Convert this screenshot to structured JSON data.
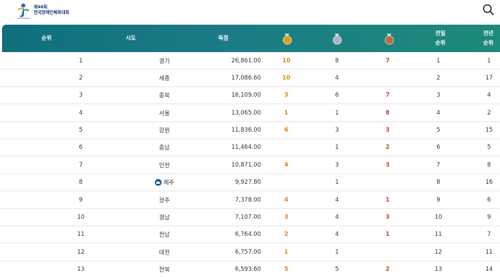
{
  "header": {
    "logo_line1": "제46회",
    "logo_line2": "전국장애인체육대회",
    "columns": {
      "rank": "순위",
      "sido": "시도",
      "score": "득점",
      "prev_day_rank_line1": "전일",
      "prev_day_rank_line2": "순위",
      "prev_year_rank_line1": "전년",
      "prev_year_rank_line2": "순위"
    },
    "medal_icons": {
      "gold": "gold-medal-icon",
      "silver": "silver-medal-icon",
      "bronze": "bronze-medal-icon"
    }
  },
  "colors": {
    "header_start": "#0f6f7c",
    "header_end": "#1d8a7a",
    "gold_text": "#d8891a",
    "bronze_text": "#b5522d"
  },
  "rows": [
    {
      "rank": "1",
      "sido": "경기",
      "score": "26,861.00",
      "gold": "10",
      "silver": "8",
      "bronze": "7",
      "prev": "1",
      "lastyr": "1"
    },
    {
      "rank": "2",
      "sido": "세종",
      "score": "17,086.60",
      "gold": "10",
      "silver": "4",
      "bronze": "",
      "prev": "2",
      "lastyr": "17"
    },
    {
      "rank": "3",
      "sido": "충북",
      "score": "16,109.00",
      "gold": "3",
      "silver": "6",
      "bronze": "7",
      "prev": "3",
      "lastyr": "4"
    },
    {
      "rank": "4",
      "sido": "서울",
      "score": "13,065.00",
      "gold": "1",
      "silver": "1",
      "bronze": "8",
      "prev": "4",
      "lastyr": "2"
    },
    {
      "rank": "5",
      "sido": "강원",
      "score": "11,836.00",
      "gold": "6",
      "silver": "3",
      "bronze": "3",
      "prev": "5",
      "lastyr": "15"
    },
    {
      "rank": "6",
      "sido": "충남",
      "score": "11,464.00",
      "gold": "",
      "silver": "1",
      "bronze": "2",
      "prev": "6",
      "lastyr": "5"
    },
    {
      "rank": "7",
      "sido": "인천",
      "score": "10,871.00",
      "gold": "4",
      "silver": "3",
      "bronze": "3",
      "prev": "7",
      "lastyr": "8"
    },
    {
      "rank": "8",
      "sido": "제주",
      "score": "9,927.80",
      "gold": "",
      "silver": "1",
      "bronze": "",
      "prev": "8",
      "lastyr": "16",
      "host": true
    },
    {
      "rank": "9",
      "sido": "광주",
      "score": "7,378.00",
      "gold": "4",
      "silver": "4",
      "bronze": "1",
      "prev": "9",
      "lastyr": "6"
    },
    {
      "rank": "10",
      "sido": "경남",
      "score": "7,107.00",
      "gold": "3",
      "silver": "4",
      "bronze": "3",
      "prev": "10",
      "lastyr": "9"
    },
    {
      "rank": "11",
      "sido": "전남",
      "score": "6,764.00",
      "gold": "2",
      "silver": "4",
      "bronze": "1",
      "prev": "11",
      "lastyr": "7"
    },
    {
      "rank": "12",
      "sido": "대전",
      "score": "6,757.00",
      "gold": "1",
      "silver": "1",
      "bronze": "",
      "prev": "12",
      "lastyr": "11"
    },
    {
      "rank": "13",
      "sido": "전북",
      "score": "6,593.60",
      "gold": "5",
      "silver": "5",
      "bronze": "2",
      "prev": "13",
      "lastyr": "14"
    }
  ]
}
